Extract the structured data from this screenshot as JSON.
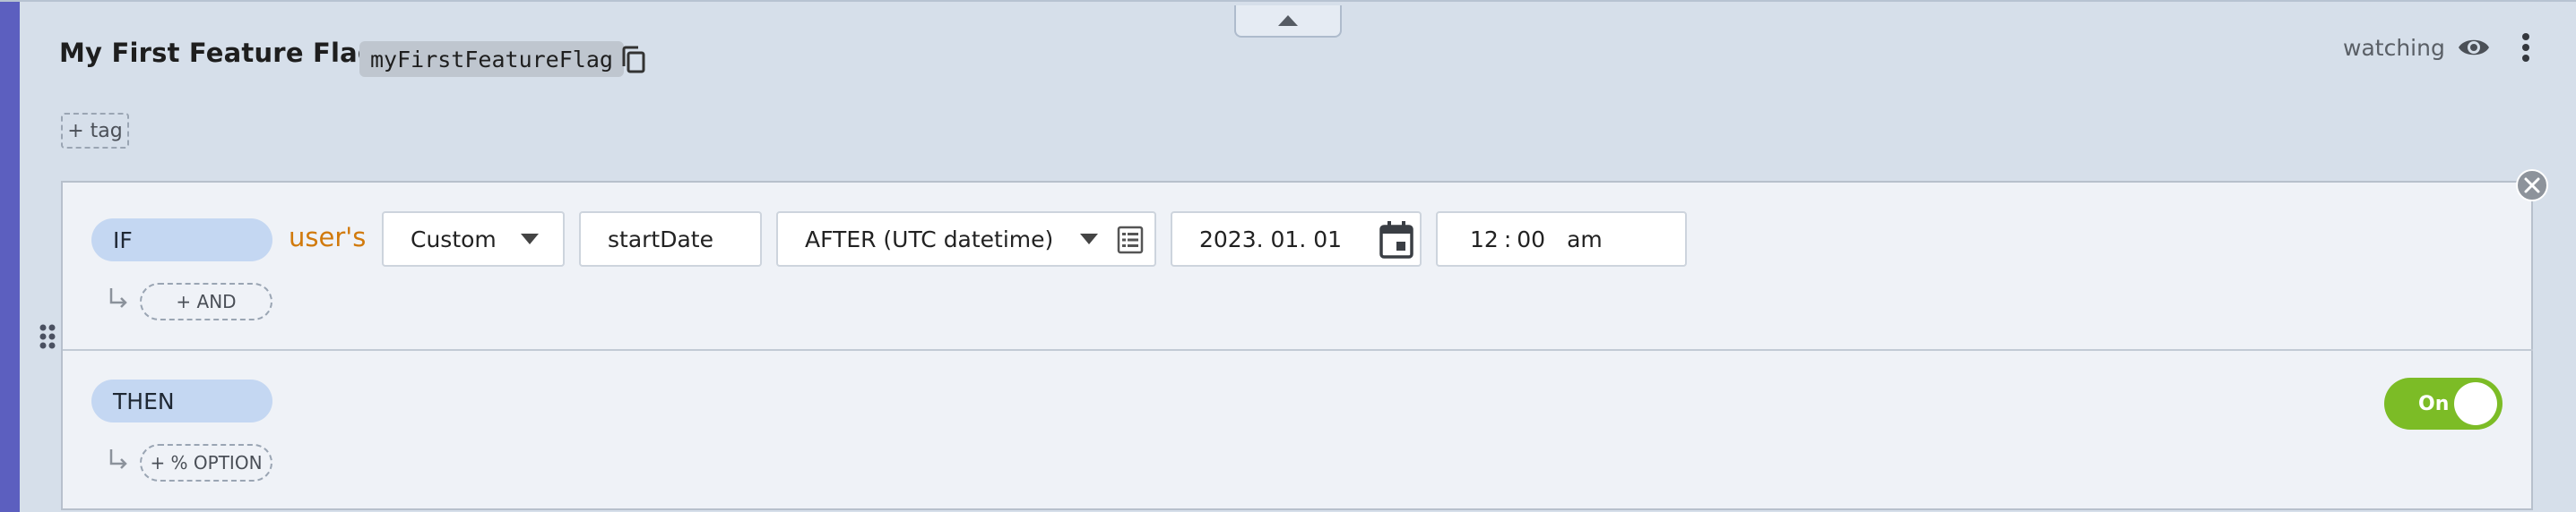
{
  "flag": {
    "name": "My First Feature Flag",
    "key": "myFirstFeatureFlag",
    "watching_label": "watching",
    "tag_button": "+ tag"
  },
  "rule": {
    "if_label": "IF",
    "subject": "user's",
    "attribute_source": "Custom",
    "attribute_name": "startDate",
    "operator": "AFTER (UTC datetime)",
    "date_value": "2023. 01. 01",
    "time_hour": "12",
    "time_minute": "00",
    "time_ampm": "am",
    "and_button": "+ AND",
    "then_label": "THEN",
    "option_button": "+ % OPTION",
    "toggle_label": "On",
    "toggle_on": true
  },
  "colors": {
    "accent": "#5c5fbf",
    "subject_orange": "#d17a0c",
    "toggle_green": "#7cbc26",
    "pill_blue": "#c4d7f2"
  },
  "icons": {
    "collapse": "chevron-up-icon",
    "copy": "copy-icon",
    "watch": "eye-icon",
    "menu": "more-vertical-icon",
    "drag": "drag-handle-icon",
    "close": "close-circle-icon",
    "operator_list": "list-icon",
    "date_picker": "calendar-icon"
  }
}
